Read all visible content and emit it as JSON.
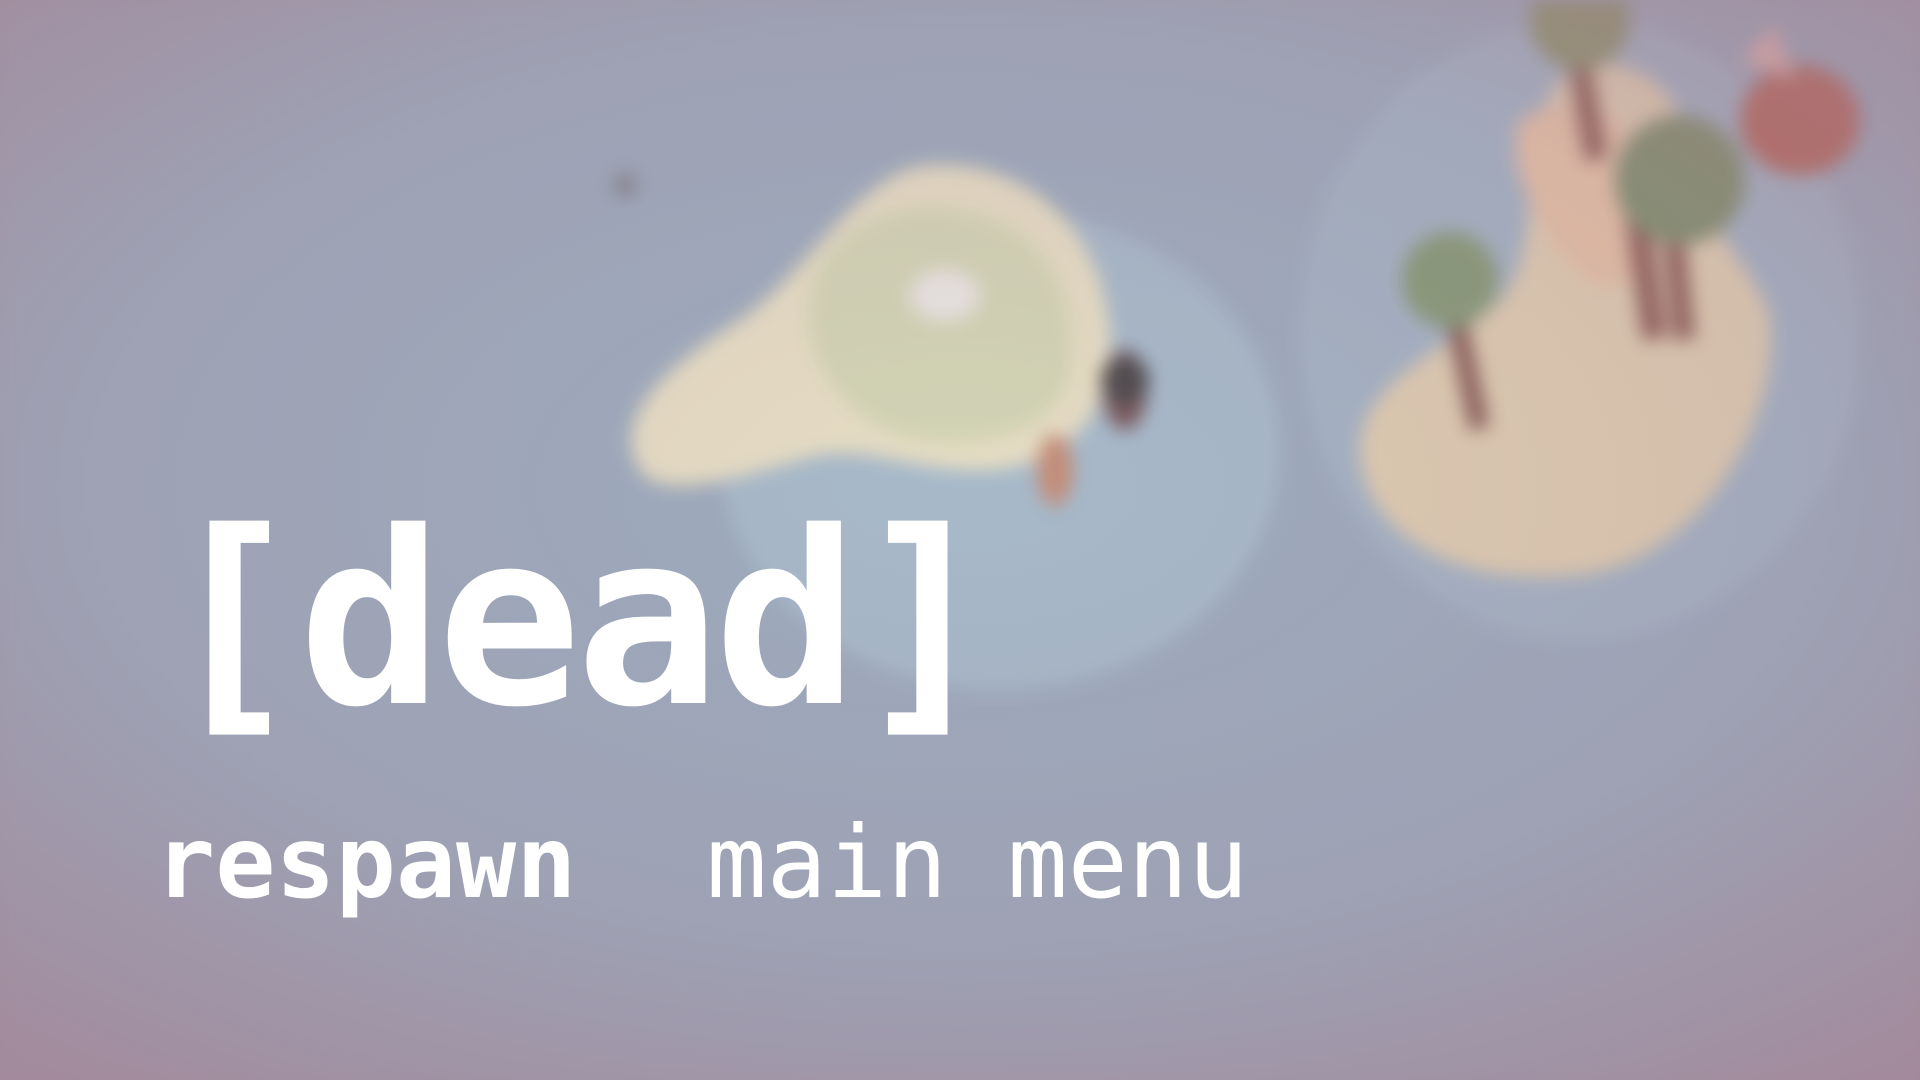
{
  "death_screen": {
    "title": "[dead]",
    "menu": [
      {
        "label": "respawn",
        "selected": true
      },
      {
        "label": "main menu",
        "selected": false
      }
    ]
  },
  "colors": {
    "text": "#ffffff",
    "water": "#93acbd",
    "sand": "#f3e9c3",
    "grass": "#d9ddb5",
    "vignette": "#a5788a"
  }
}
